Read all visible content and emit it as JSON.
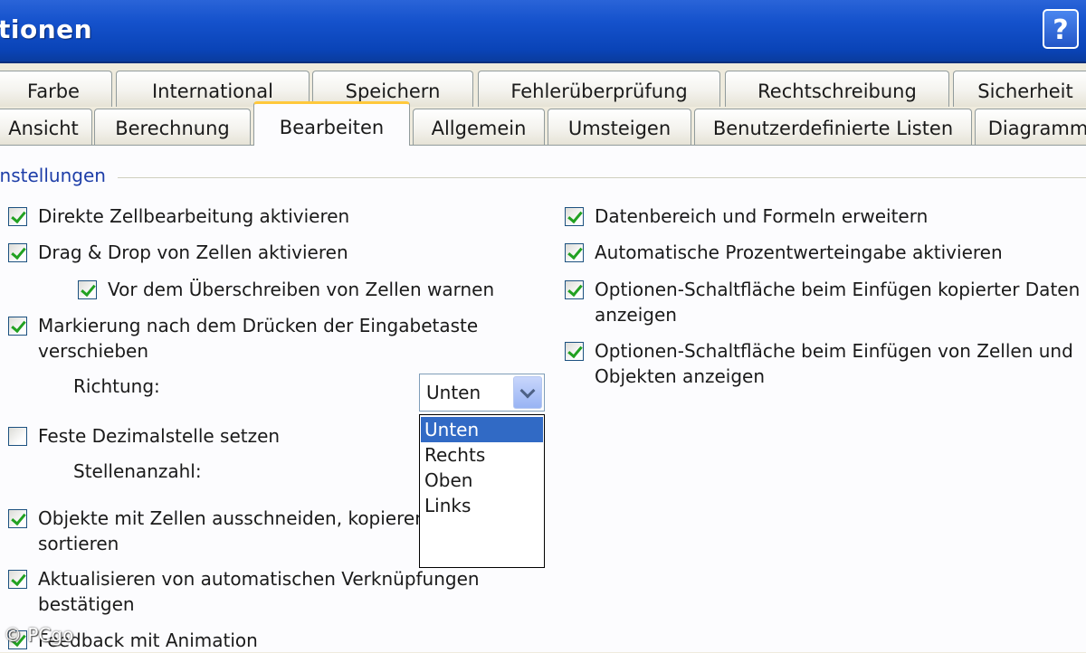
{
  "window": {
    "title": "tionen",
    "help_label": "?"
  },
  "tabs_row1": [
    "Farbe",
    "International",
    "Speichern",
    "Fehlerüberprüfung",
    "Rechtschreibung",
    "Sicherheit"
  ],
  "tabs_row2": [
    "Ansicht",
    "Berechnung",
    "Bearbeiten",
    "Allgemein",
    "Umsteigen",
    "Benutzerdefinierte Listen",
    "Diagramm"
  ],
  "active_tab": "Bearbeiten",
  "group": {
    "title": "instellungen"
  },
  "left_options": {
    "direct_edit": "Direkte Zellbearbeitung aktivieren",
    "drag_drop": "Drag & Drop von Zellen aktivieren",
    "warn_overwrite": "Vor dem Überschreiben von Zellen warnen",
    "move_after_enter_1": "Markierung nach dem Drücken der Eingabetaste",
    "move_after_enter_2": "verschieben",
    "direction_label": "Richtung:",
    "fixed_decimal": "Feste Dezimalstelle setzen",
    "places_label": "Stellenanzahl:",
    "cut_copy_sort_1": "Objekte mit Zellen ausschneiden, kopieren",
    "cut_copy_sort_2": "sortieren",
    "update_links_1": "Aktualisieren von automatischen Verknüpfungen",
    "update_links_2": "bestätigen",
    "feedback_animation": "Feedback mit Animation"
  },
  "right_options": {
    "extend_formats": "Datenbereich und Formeln erweitern",
    "auto_percent": "Automatische Prozentwerteingabe aktivieren",
    "paste_options_1": "Optionen-Schaltfläche beim Einfügen kopierter Daten",
    "paste_options_2": "anzeigen",
    "insert_options_1": "Optionen-Schaltfläche beim Einfügen von Zellen und",
    "insert_options_2": "Objekten anzeigen"
  },
  "checked": {
    "direct_edit": true,
    "drag_drop": true,
    "warn_overwrite": true,
    "move_after_enter": true,
    "fixed_decimal": false,
    "cut_copy_sort": true,
    "update_links": true,
    "feedback_animation": true,
    "extend_formats": true,
    "auto_percent": true,
    "paste_options": true,
    "insert_options": true
  },
  "direction_select": {
    "value": "Unten",
    "options": [
      "Unten",
      "Rechts",
      "Oben",
      "Links"
    ],
    "highlighted": "Unten"
  },
  "watermark": "© PCgo",
  "colors": {
    "titlebar": "#0a44b8",
    "selection": "#316ac5",
    "active_tab_accent": "#ffc83c",
    "check": "#21a121"
  }
}
